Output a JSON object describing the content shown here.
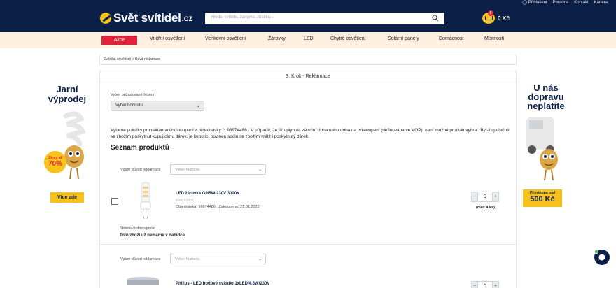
{
  "header": {
    "toplinks": [
      "Přihlášení",
      "Poradna",
      "Kontakt",
      "Kariéra"
    ],
    "logo_main": "Svět svítidel",
    "logo_tld": ".cz",
    "search_placeholder": "Hledej svítidlo, žárovku, značku...",
    "cart_count": "0",
    "cart_total": "0 Kč"
  },
  "nav": {
    "items": [
      "Akce",
      "Vnitřní osvětlení",
      "Venkovní osvětlení",
      "Žárovky",
      "LED",
      "Chytré osvětlení",
      "Solární panely",
      "Domácnost",
      "Místnosti"
    ]
  },
  "breadcrumb": "Svítidla, osvětlení > Nová reklamace",
  "form": {
    "step_title": "3. Krok - Reklamace",
    "solution_label": "Vyber požadované řešení",
    "solution_value": "Vyber hodnotu",
    "info_text": "Vyberte položky pro reklamaci/odstoupení z objednávky č. 96974486 . V případě, že již uplynula záruční doba nebo doba na odstoupení (definována ve VOP), není možné produkt vybrat. Byl-li společně se zbožím poskytnut kupujícímu dárek, je kupující povinen spolu se zbožím vrátit i poskytnutý dárek.",
    "products_title": "Seznam produktů"
  },
  "products": [
    {
      "reason_label": "Vyber důvod reklamace",
      "reason_placeholder": "Vyber hodnotu",
      "name": "LED žárovka G9/5W/230V 3000K",
      "code": "Kód: 01005",
      "order": "Objednávka: 96974486 , Zakoupeno: 21.01.2022",
      "qty": "0",
      "max": "(max 4 ks)",
      "stock_label": "Skladová dostupnost",
      "stock_value": "Toto zboží už nemáme v nabídce"
    },
    {
      "reason_label": "Vyber důvod reklamace",
      "reason_placeholder": "Vyber hodnotu",
      "name": "Philips - LED bodové svítidlo 1xLED/4,5W/230V",
      "qty": "0"
    }
  ],
  "banner_left": {
    "title_line1": "Jarní",
    "title_line2": "výprodej",
    "badge_top": "Slevy až",
    "badge_value": "70%",
    "button": "Více zde"
  },
  "banner_right": {
    "title_line1": "U nás",
    "title_line2": "dopravu",
    "title_line3": "neplatíte",
    "badge_top": "Při nákupu nad",
    "badge_value": "500 Kč"
  },
  "colors": {
    "navy": "#0c2047",
    "yellow": "#f7c21b",
    "red": "#e0233a",
    "nav_bg": "#fdf0df"
  }
}
